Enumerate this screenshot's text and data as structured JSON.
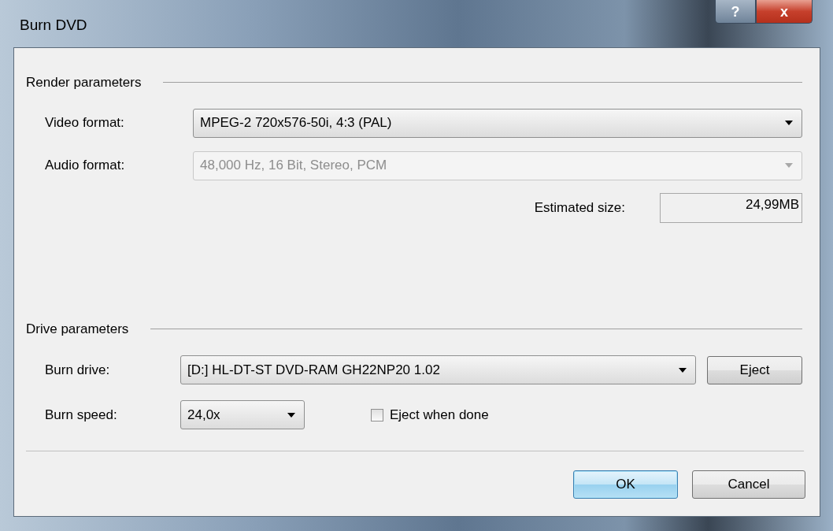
{
  "window": {
    "title": "Burn DVD",
    "title_buttons": [
      {
        "kind": "help",
        "label": "?"
      },
      {
        "kind": "close",
        "label": "x"
      }
    ]
  },
  "render_parameters": {
    "heading": "Render parameters",
    "video_format": {
      "label": "Video format:",
      "value": "MPEG-2 720x576-50i, 4:3 (PAL)",
      "disabled": false
    },
    "audio_format": {
      "label": "Audio format:",
      "value": "48,000 Hz, 16 Bit, Stereo, PCM",
      "disabled": true
    },
    "estimated_size": {
      "label": "Estimated size:",
      "value": "24,99MB"
    }
  },
  "drive_parameters": {
    "heading": "Drive parameters",
    "burn_drive": {
      "label": "Burn drive:",
      "value": "[D:] HL-DT-ST DVD-RAM GH22NP20 1.02",
      "disabled": false
    },
    "eject_button": "Eject",
    "burn_speed": {
      "label": "Burn speed:",
      "value": "24,0x",
      "disabled": false
    },
    "eject_when_done": {
      "label": "Eject when done",
      "checked": false
    }
  },
  "buttons": [
    {
      "label": "OK",
      "default": true
    },
    {
      "label": "Cancel",
      "default": false
    }
  ]
}
